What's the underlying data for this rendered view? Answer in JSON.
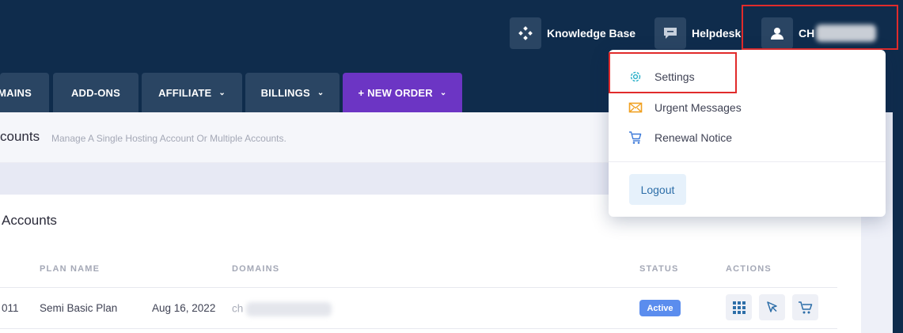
{
  "topbar": {
    "knowledge_base": "Knowledge Base",
    "helpdesk": "Helpdesk",
    "user_prefix": "CH"
  },
  "nav": {
    "tabs": [
      {
        "label": "MAINS"
      },
      {
        "label": "ADD-ONS"
      },
      {
        "label": "AFFILIATE"
      },
      {
        "label": "BILLINGS"
      },
      {
        "label": "+ NEW ORDER"
      }
    ]
  },
  "page": {
    "title": "counts",
    "subtitle": "Manage A Single Hosting Account Or Multiple Accounts.",
    "card_title": "Accounts"
  },
  "table": {
    "headers": [
      "PLAN NAME",
      "DOMAINS",
      "STATUS",
      "ACTIONS"
    ],
    "rows": [
      {
        "id": "011",
        "plan": "Semi Basic Plan",
        "date": "Aug 16, 2022",
        "domain_prefix": "ch",
        "status": "Active"
      }
    ]
  },
  "dropdown": {
    "items": [
      {
        "label": "Settings",
        "icon": "gear-icon"
      },
      {
        "label": "Urgent Messages",
        "icon": "envelope-icon"
      },
      {
        "label": "Renewal Notice",
        "icon": "cart-icon"
      }
    ],
    "logout": "Logout"
  },
  "colors": {
    "navy": "#0f2c4c",
    "tab": "#2a4563",
    "new_order": "#6c35c4",
    "badge": "#5b8dee",
    "highlight": "#e12b2b"
  }
}
